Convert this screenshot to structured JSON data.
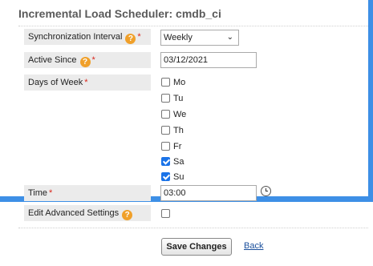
{
  "title": "Incremental Load Scheduler: cmdb_ci",
  "fields": {
    "interval": {
      "label": "Synchronization Interval",
      "value": "Weekly"
    },
    "active_since": {
      "label": "Active Since",
      "value": "03/12/2021"
    },
    "days_of_week": {
      "label": "Days of Week"
    },
    "time": {
      "label": "Time",
      "value": "03:00"
    },
    "advanced": {
      "label": "Edit Advanced Settings",
      "checked": false
    }
  },
  "days": [
    {
      "label": "Mo",
      "checked": false
    },
    {
      "label": "Tu",
      "checked": false
    },
    {
      "label": "We",
      "checked": false
    },
    {
      "label": "Th",
      "checked": false
    },
    {
      "label": "Fr",
      "checked": false
    },
    {
      "label": "Sa",
      "checked": true
    },
    {
      "label": "Su",
      "checked": true
    }
  ],
  "required_marker": "*",
  "help_glyph": "?",
  "actions": {
    "save_label": "Save Changes",
    "back_label": "Back"
  },
  "colors": {
    "background": "#3d8fe6",
    "help_icon": "#f0a02a",
    "checkbox_checked": "#1a73e8",
    "required": "#d9261c"
  }
}
